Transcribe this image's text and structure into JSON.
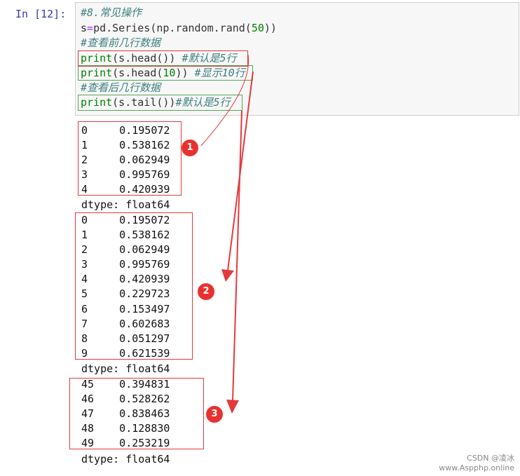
{
  "prompt": "In  [12]:",
  "code": {
    "line1": "#8.常见操作",
    "line2_pre": "s",
    "line2_op": "=",
    "line2_mid": "pd.Series(np.random.rand(",
    "line2_num": "50",
    "line2_post": "))",
    "line3": "#查看前几行数据",
    "line4_kw": "print",
    "line4_code": "(s.head())",
    "line4_cm": "#默认是5行",
    "line5_kw": "print",
    "line5_code1": "(s.head(",
    "line5_num": "10",
    "line5_code2": "))",
    "line5_cm": "#显示10行",
    "line6": "#查看后几行数据",
    "line7_kw": "print",
    "line7_code": "(s.tail())",
    "line7_cm": "#默认是5行"
  },
  "outputs": {
    "head": [
      "0     0.195072",
      "1     0.538162",
      "2     0.062949",
      "3     0.995769",
      "4     0.420939"
    ],
    "head10": [
      "0     0.195072",
      "1     0.538162",
      "2     0.062949",
      "3     0.995769",
      "4     0.420939",
      "5     0.229723",
      "6     0.153497",
      "7     0.602683",
      "8     0.051297",
      "9     0.621539"
    ],
    "tail": [
      "45    0.394831",
      "46    0.528262",
      "47    0.838463",
      "48    0.128830",
      "49    0.253219"
    ],
    "dtype": "dtype: float64"
  },
  "badges": [
    "1",
    "2",
    "3"
  ],
  "watermark": {
    "line1": "CSDN @凌冰",
    "line2": "www.Aspphp.online"
  },
  "colors": {
    "annotation_red": "#e4393c",
    "annotation_green": "#57a557",
    "badge": "#e8322f"
  }
}
